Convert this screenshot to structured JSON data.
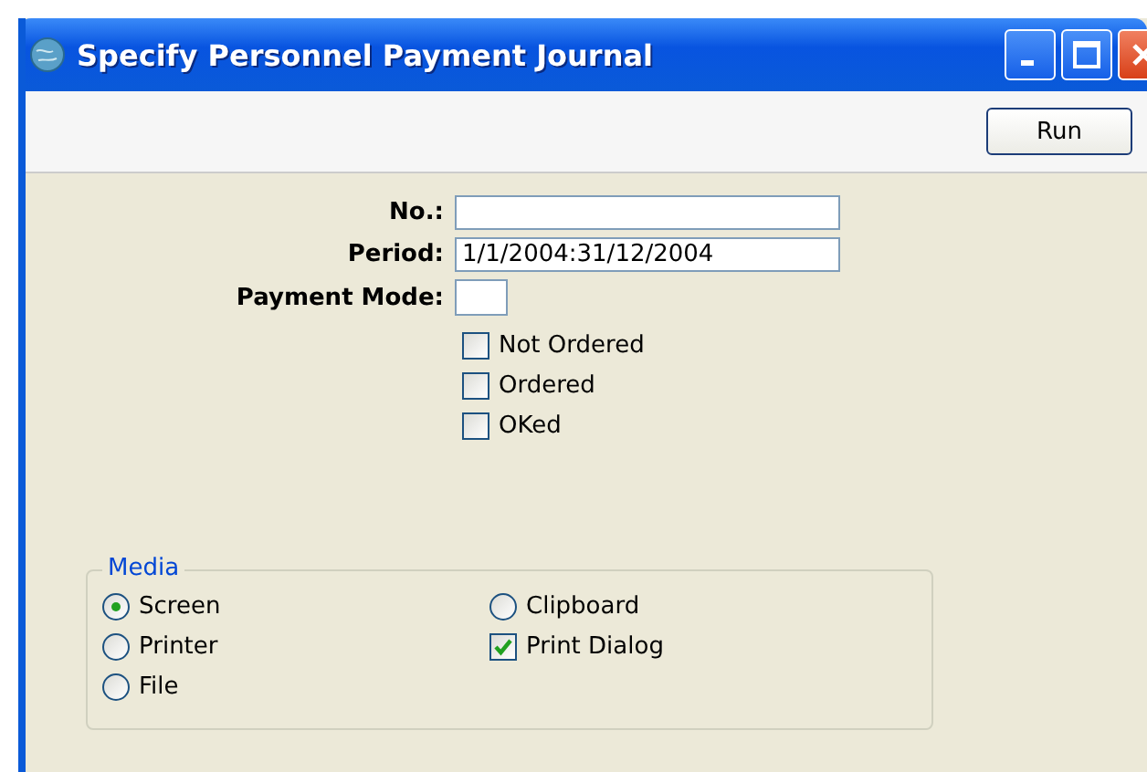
{
  "window": {
    "title": "Specify Personnel Payment Journal"
  },
  "toolbar": {
    "buttons": [
      "Run"
    ]
  },
  "fields": [
    {
      "label": "No.:",
      "kind": "long"
    },
    {
      "label": "Period:",
      "value": "1/1/2004:31/12/2004",
      "kind": "long"
    },
    {
      "label": "Payment Mode:",
      "kind": "short"
    }
  ],
  "checkboxes": [
    {
      "label": "Not Ordered",
      "checked": false
    },
    {
      "label": "Ordered",
      "checked": false
    },
    {
      "label": "OKed",
      "checked": false
    }
  ],
  "media": {
    "title": "Media",
    "items": [
      {
        "kind": "radio",
        "label": "Screen",
        "selected": true
      },
      {
        "kind": "radio",
        "label": "Clipboard",
        "selected": false
      },
      {
        "kind": "radio",
        "label": "Printer",
        "selected": false
      },
      {
        "kind": "checkbox",
        "label": "Print Dialog",
        "checked": true
      },
      {
        "kind": "radio",
        "label": "File",
        "selected": false
      }
    ]
  }
}
